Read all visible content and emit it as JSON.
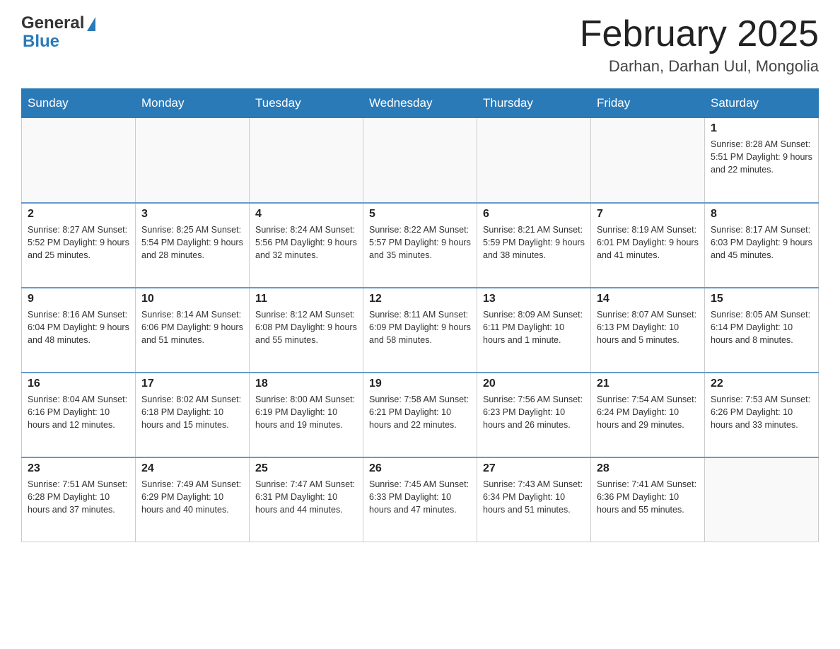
{
  "header": {
    "logo_general": "General",
    "logo_blue": "Blue",
    "month_title": "February 2025",
    "location": "Darhan, Darhan Uul, Mongolia"
  },
  "weekdays": [
    "Sunday",
    "Monday",
    "Tuesday",
    "Wednesday",
    "Thursday",
    "Friday",
    "Saturday"
  ],
  "weeks": [
    [
      {
        "day": "",
        "info": ""
      },
      {
        "day": "",
        "info": ""
      },
      {
        "day": "",
        "info": ""
      },
      {
        "day": "",
        "info": ""
      },
      {
        "day": "",
        "info": ""
      },
      {
        "day": "",
        "info": ""
      },
      {
        "day": "1",
        "info": "Sunrise: 8:28 AM\nSunset: 5:51 PM\nDaylight: 9 hours and 22 minutes."
      }
    ],
    [
      {
        "day": "2",
        "info": "Sunrise: 8:27 AM\nSunset: 5:52 PM\nDaylight: 9 hours and 25 minutes."
      },
      {
        "day": "3",
        "info": "Sunrise: 8:25 AM\nSunset: 5:54 PM\nDaylight: 9 hours and 28 minutes."
      },
      {
        "day": "4",
        "info": "Sunrise: 8:24 AM\nSunset: 5:56 PM\nDaylight: 9 hours and 32 minutes."
      },
      {
        "day": "5",
        "info": "Sunrise: 8:22 AM\nSunset: 5:57 PM\nDaylight: 9 hours and 35 minutes."
      },
      {
        "day": "6",
        "info": "Sunrise: 8:21 AM\nSunset: 5:59 PM\nDaylight: 9 hours and 38 minutes."
      },
      {
        "day": "7",
        "info": "Sunrise: 8:19 AM\nSunset: 6:01 PM\nDaylight: 9 hours and 41 minutes."
      },
      {
        "day": "8",
        "info": "Sunrise: 8:17 AM\nSunset: 6:03 PM\nDaylight: 9 hours and 45 minutes."
      }
    ],
    [
      {
        "day": "9",
        "info": "Sunrise: 8:16 AM\nSunset: 6:04 PM\nDaylight: 9 hours and 48 minutes."
      },
      {
        "day": "10",
        "info": "Sunrise: 8:14 AM\nSunset: 6:06 PM\nDaylight: 9 hours and 51 minutes."
      },
      {
        "day": "11",
        "info": "Sunrise: 8:12 AM\nSunset: 6:08 PM\nDaylight: 9 hours and 55 minutes."
      },
      {
        "day": "12",
        "info": "Sunrise: 8:11 AM\nSunset: 6:09 PM\nDaylight: 9 hours and 58 minutes."
      },
      {
        "day": "13",
        "info": "Sunrise: 8:09 AM\nSunset: 6:11 PM\nDaylight: 10 hours and 1 minute."
      },
      {
        "day": "14",
        "info": "Sunrise: 8:07 AM\nSunset: 6:13 PM\nDaylight: 10 hours and 5 minutes."
      },
      {
        "day": "15",
        "info": "Sunrise: 8:05 AM\nSunset: 6:14 PM\nDaylight: 10 hours and 8 minutes."
      }
    ],
    [
      {
        "day": "16",
        "info": "Sunrise: 8:04 AM\nSunset: 6:16 PM\nDaylight: 10 hours and 12 minutes."
      },
      {
        "day": "17",
        "info": "Sunrise: 8:02 AM\nSunset: 6:18 PM\nDaylight: 10 hours and 15 minutes."
      },
      {
        "day": "18",
        "info": "Sunrise: 8:00 AM\nSunset: 6:19 PM\nDaylight: 10 hours and 19 minutes."
      },
      {
        "day": "19",
        "info": "Sunrise: 7:58 AM\nSunset: 6:21 PM\nDaylight: 10 hours and 22 minutes."
      },
      {
        "day": "20",
        "info": "Sunrise: 7:56 AM\nSunset: 6:23 PM\nDaylight: 10 hours and 26 minutes."
      },
      {
        "day": "21",
        "info": "Sunrise: 7:54 AM\nSunset: 6:24 PM\nDaylight: 10 hours and 29 minutes."
      },
      {
        "day": "22",
        "info": "Sunrise: 7:53 AM\nSunset: 6:26 PM\nDaylight: 10 hours and 33 minutes."
      }
    ],
    [
      {
        "day": "23",
        "info": "Sunrise: 7:51 AM\nSunset: 6:28 PM\nDaylight: 10 hours and 37 minutes."
      },
      {
        "day": "24",
        "info": "Sunrise: 7:49 AM\nSunset: 6:29 PM\nDaylight: 10 hours and 40 minutes."
      },
      {
        "day": "25",
        "info": "Sunrise: 7:47 AM\nSunset: 6:31 PM\nDaylight: 10 hours and 44 minutes."
      },
      {
        "day": "26",
        "info": "Sunrise: 7:45 AM\nSunset: 6:33 PM\nDaylight: 10 hours and 47 minutes."
      },
      {
        "day": "27",
        "info": "Sunrise: 7:43 AM\nSunset: 6:34 PM\nDaylight: 10 hours and 51 minutes."
      },
      {
        "day": "28",
        "info": "Sunrise: 7:41 AM\nSunset: 6:36 PM\nDaylight: 10 hours and 55 minutes."
      },
      {
        "day": "",
        "info": ""
      }
    ]
  ]
}
